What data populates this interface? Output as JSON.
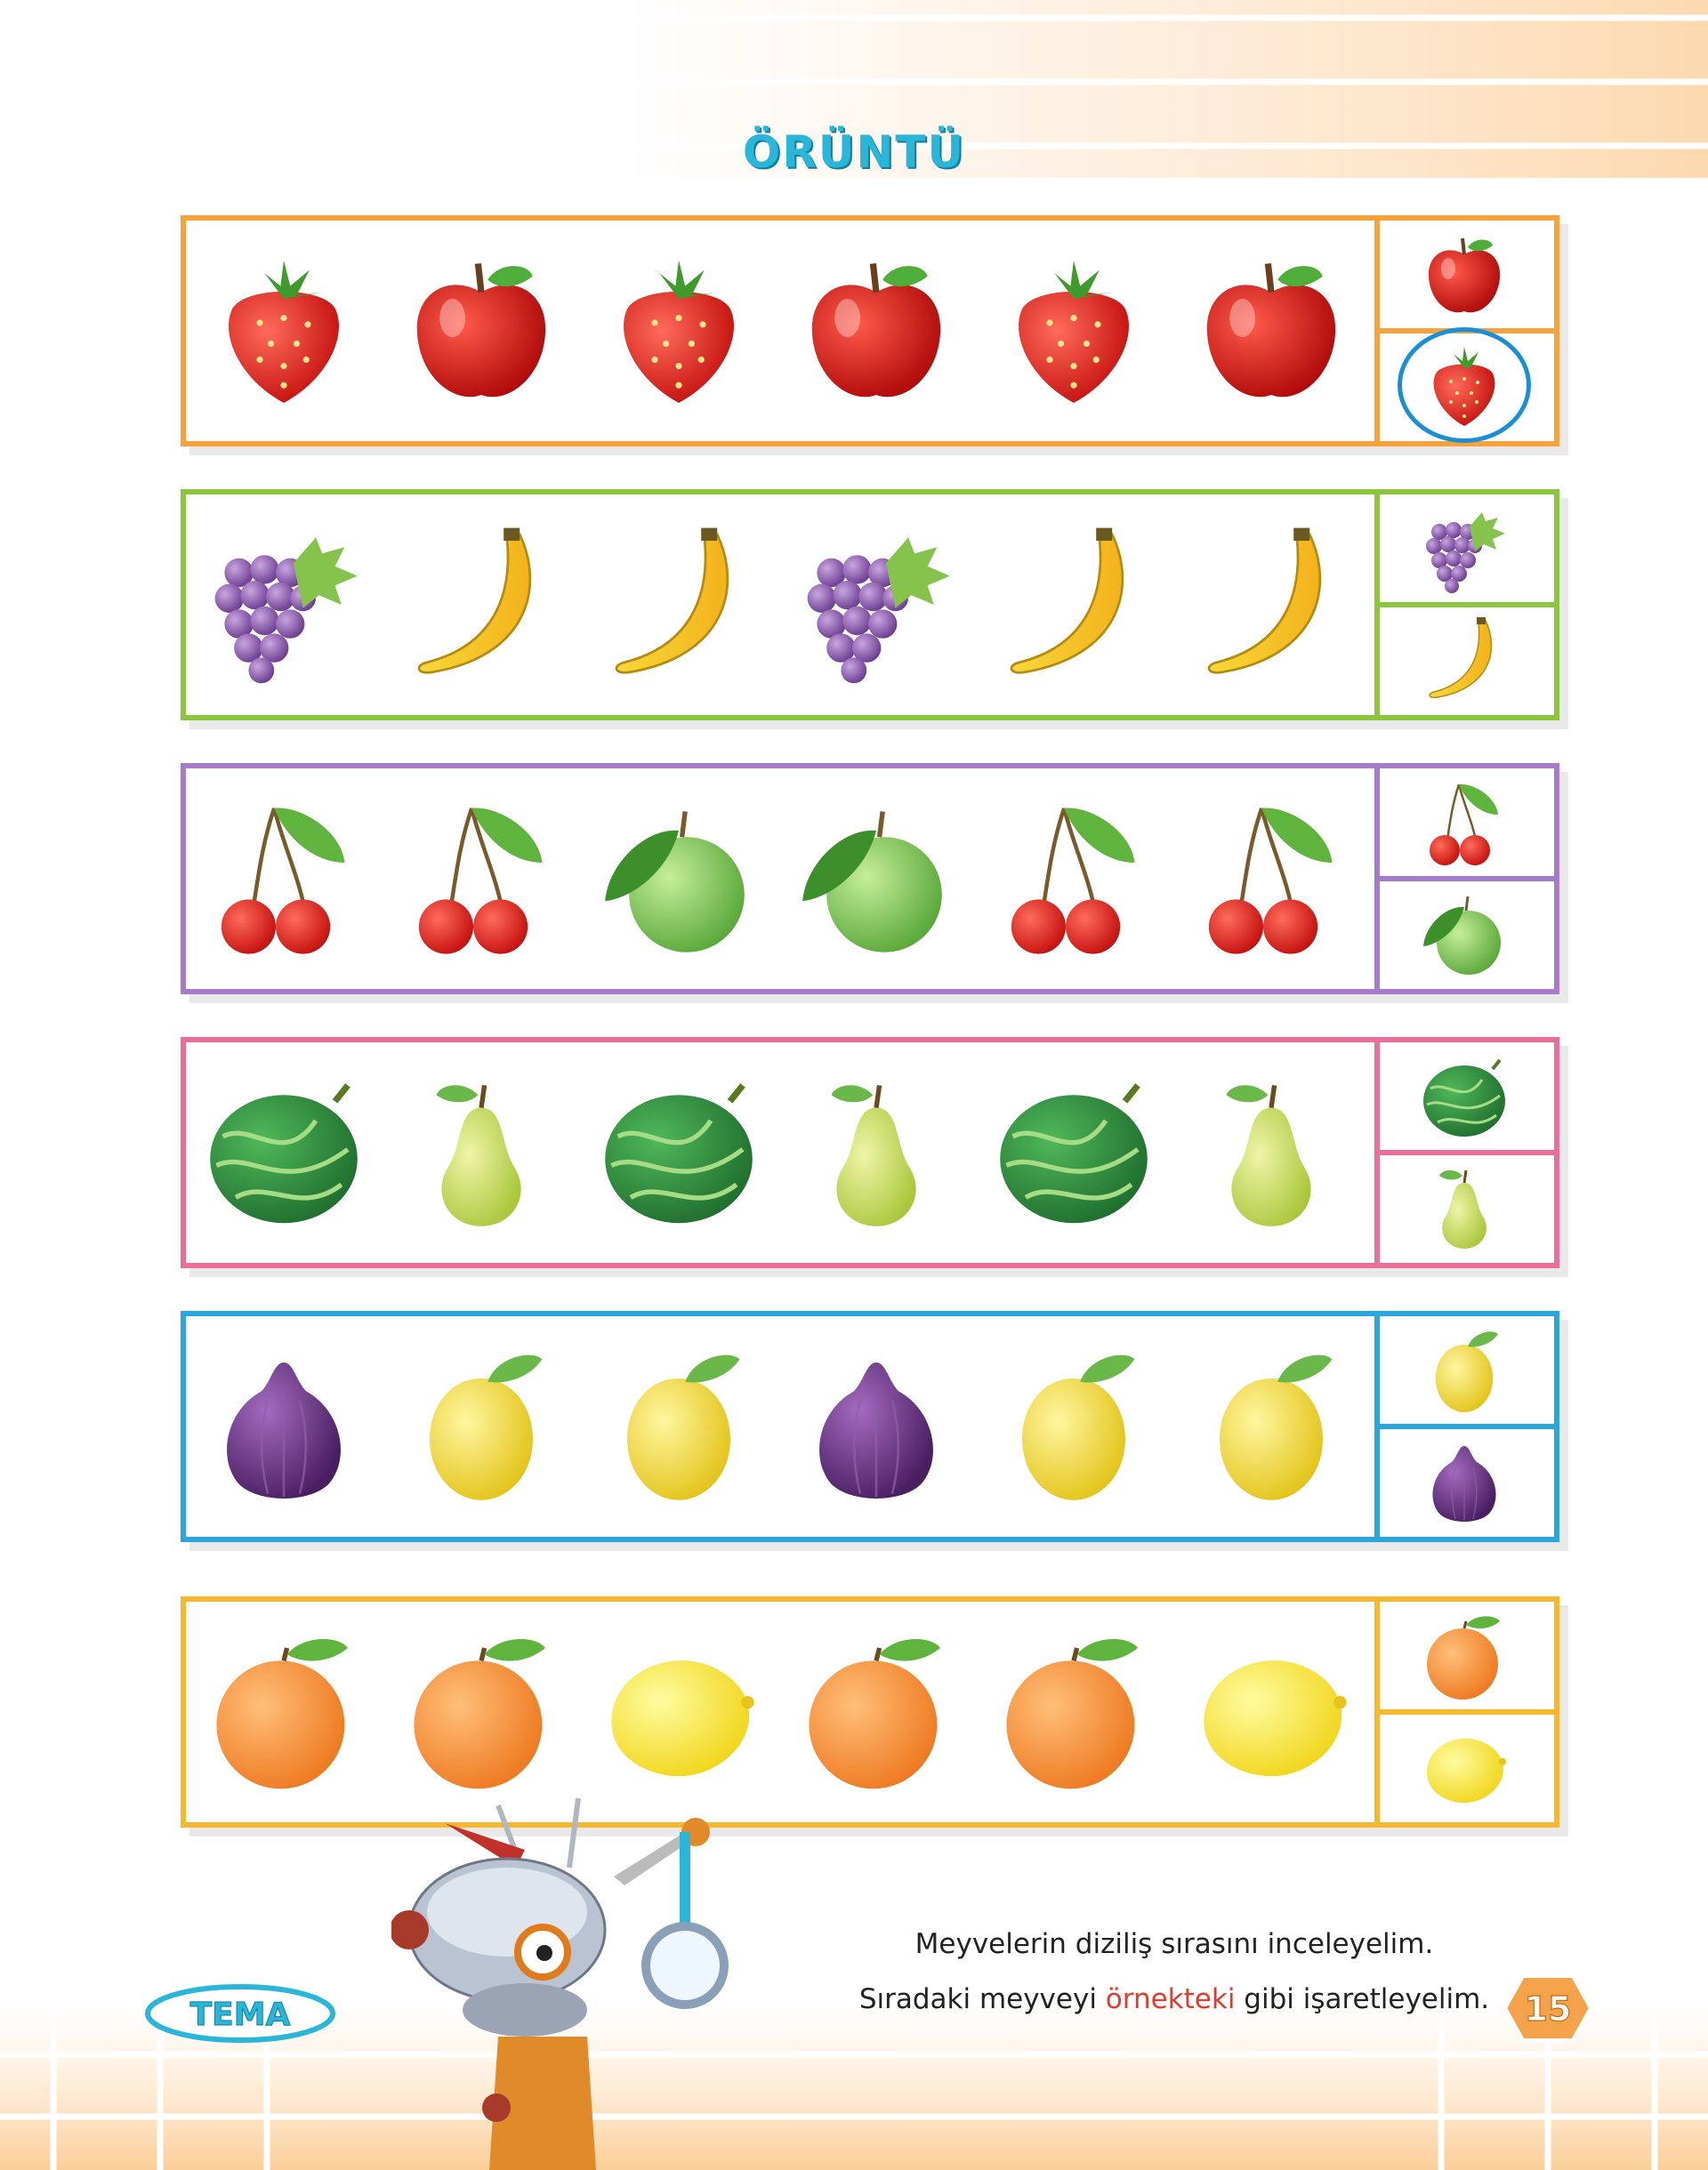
{
  "title": "ÖRÜNTÜ",
  "rows": [
    {
      "color": "#f7a23b",
      "sequence": [
        "strawberry",
        "apple",
        "strawberry",
        "apple",
        "strawberry",
        "apple"
      ],
      "options": [
        "apple",
        "strawberry"
      ],
      "marked_option": 1
    },
    {
      "color": "#8cc63f",
      "sequence": [
        "grapes",
        "banana",
        "banana",
        "grapes",
        "banana",
        "banana"
      ],
      "options": [
        "grapes",
        "banana"
      ]
    },
    {
      "color": "#a77bc9",
      "sequence": [
        "cherry",
        "cherry",
        "green-plum",
        "green-plum",
        "cherry",
        "cherry"
      ],
      "options": [
        "cherry",
        "green-plum"
      ]
    },
    {
      "color": "#ec6f9b",
      "sequence": [
        "watermelon",
        "pear",
        "watermelon",
        "pear",
        "watermelon",
        "pear"
      ],
      "options": [
        "watermelon",
        "pear"
      ]
    },
    {
      "color": "#2ba6dd",
      "sequence": [
        "fig",
        "quince",
        "quince",
        "fig",
        "quince",
        "quince"
      ],
      "options": [
        "quince",
        "fig"
      ]
    },
    {
      "color": "#f9b82b",
      "sequence": [
        "orange",
        "orange",
        "lemon",
        "orange",
        "orange",
        "lemon"
      ],
      "options": [
        "orange",
        "lemon"
      ]
    }
  ],
  "instructions": {
    "line1": "Meyvelerin diziliş sırasını inceleyelim.",
    "line2_before": "Sıradaki meyveyi ",
    "line2_highlight": "örnekteki",
    "line2_after": " gibi işaretleyelim."
  },
  "logo_text": "TEMA",
  "page_number": "15",
  "colors": {
    "title": "#29b6d8",
    "highlight": "#e63a2e",
    "circle": "#1b8fd6"
  }
}
